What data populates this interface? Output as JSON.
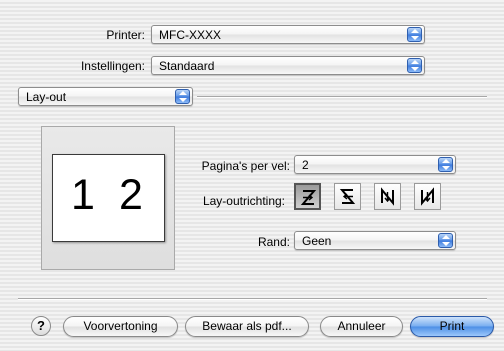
{
  "printer": {
    "label": "Printer:",
    "value": "MFC-XXXX"
  },
  "settings": {
    "label": "Instellingen:",
    "value": "Standaard"
  },
  "panel": {
    "value": "Lay-out"
  },
  "preview": {
    "page1": "1",
    "page2": "2"
  },
  "layout": {
    "pages_per_sheet": {
      "label": "Pagina's per vel:",
      "value": "2"
    },
    "direction": {
      "label": "Lay-outrichting:",
      "options": [
        "z-left-right",
        "z-right-left",
        "n-top-bottom",
        "n-top-bottom-reverse"
      ],
      "selected_index": 0
    },
    "border": {
      "label": "Rand:",
      "value": "Geen"
    }
  },
  "buttons": {
    "help": "?",
    "preview": "Voorvertoning",
    "save_pdf": "Bewaar als pdf...",
    "cancel": "Annuleer",
    "print": "Print"
  },
  "colors": {
    "accent": "#4d8fe6",
    "background": "#ececec"
  }
}
